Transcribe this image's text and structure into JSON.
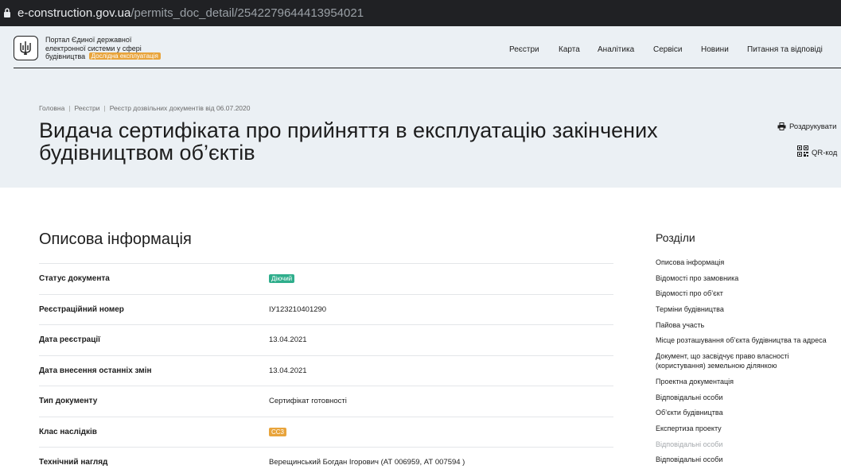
{
  "browser": {
    "url_host": "e-construction.gov.ua",
    "url_path": "/permits_doc_detail/2542279644413954021"
  },
  "header": {
    "portal_title": "Портал Єдиної державної електронної системи у сфері будівництва",
    "beta_badge": "Дослідна експлуатація",
    "nav": [
      "Реєстри",
      "Карта",
      "Аналітика",
      "Сервіси",
      "Новини",
      "Питання та відповіді"
    ]
  },
  "breadcrumb": [
    "Головна",
    "Реєстри",
    "Реєстр дозвільних документів від 06.07.2020"
  ],
  "page": {
    "title": "Видача сертифіката про прийняття в експлуатацію закінчених будівництвом об’єктів",
    "print_label": "Роздрукувати",
    "qr_label": "QR-код"
  },
  "info": {
    "heading": "Описова інформація",
    "rows": [
      {
        "label": "Статус документа",
        "value": "Діючий"
      },
      {
        "label": "Реєстраційний номер",
        "value": "ІУ123210401290"
      },
      {
        "label": "Дата реєстрації",
        "value": "13.04.2021"
      },
      {
        "label": "Дата внесення останніх змін",
        "value": "13.04.2021"
      },
      {
        "label": "Тип документу",
        "value": "Сертифікат готовності"
      },
      {
        "label": "Клас наслідків",
        "value": "СС3"
      },
      {
        "label": "Технічний нагляд",
        "value": "Верещинський Богдан Ігорович (АТ 006959, АТ 007594 )"
      }
    ]
  },
  "colors": {
    "status_active": "#2fae8c",
    "class_badge": "#e8a43c"
  },
  "sections": {
    "heading": "Розділи",
    "items": [
      "Описова інформація",
      "Відомості про замовника",
      "Відомості про об’єкт",
      "Терміни будівництва",
      "Пайова участь",
      "Місце розташування об’єкта будівництва та адреса",
      "Документ, що засвідчує право власності (користування) земельною ділянкою",
      "Проектна документація",
      "Відповідальні особи",
      "Об’єкти будівництва",
      "Експертиза проекту",
      "Відповідальні особи",
      "Відповідальні особи"
    ]
  }
}
